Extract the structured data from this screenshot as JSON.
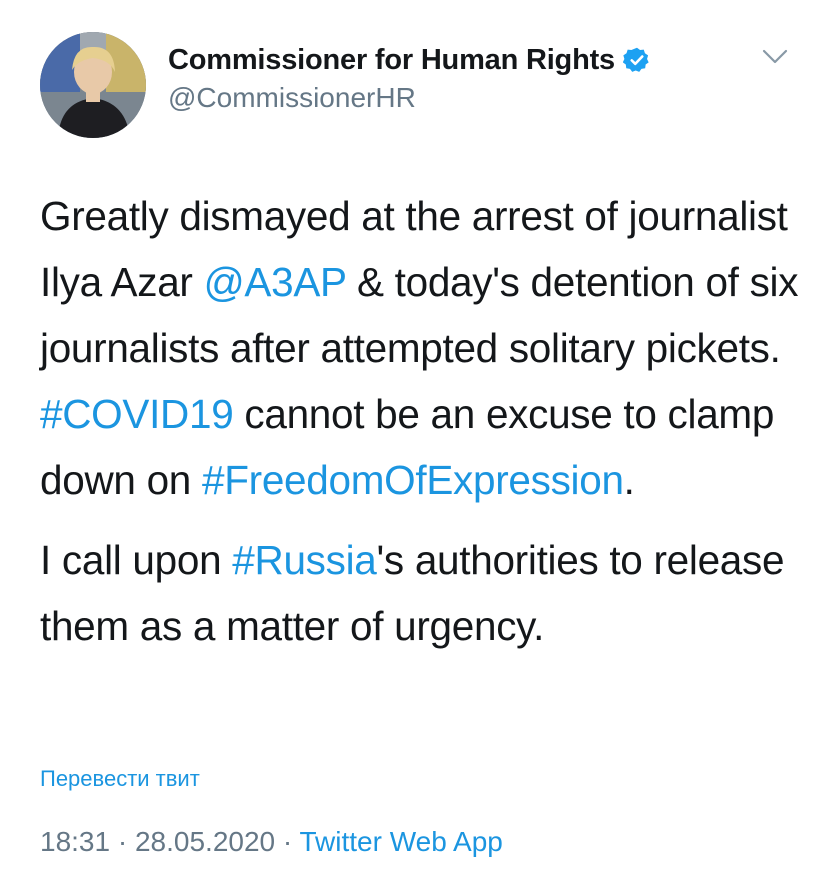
{
  "user": {
    "display_name": "Commissioner for Human Rights",
    "handle": "@CommissionerHR",
    "avatar_icon": "avatar-photo",
    "verified_icon": "verified-badge-icon"
  },
  "menu_icon": "chevron-down-icon",
  "tweet": {
    "p1": {
      "t1": "Greatly dismayed at the arrest of journalist Ilya Azar ",
      "mention": "@A3AP",
      "t2": " & today's detention of six journalists after attempted solitary pickets. ",
      "hashtag1": "#COVID19",
      "t3": " cannot be an excuse to clamp down on ",
      "hashtag2": "#FreedomOfExpression",
      "t4": "."
    },
    "p2": {
      "t1": "I call upon ",
      "hashtag": "#Russia",
      "t2": "'s authorities to release them as a matter of urgency."
    }
  },
  "translate_label": "Перевести твит",
  "meta": {
    "time": "18:31",
    "sep1": " · ",
    "date": "28.05.2020",
    "sep2": " · ",
    "source": "Twitter Web App"
  },
  "colors": {
    "link": "#1b95e0",
    "secondary": "#657786",
    "text": "#14171a"
  }
}
